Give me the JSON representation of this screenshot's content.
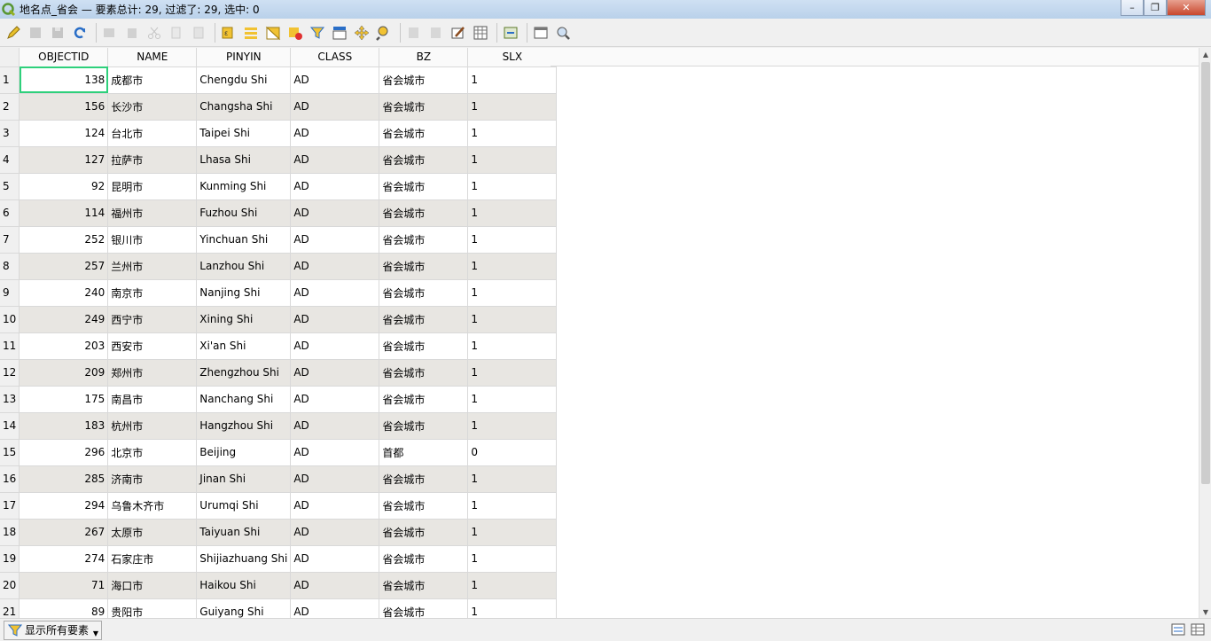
{
  "window": {
    "title": "地名点_省会 — 要素总计: 29, 过滤了: 29, 选中: 0",
    "minimize": "–",
    "maximize": "❐",
    "close": "✕"
  },
  "table": {
    "columns": [
      "OBJECTID",
      "NAME",
      "PINYIN",
      "CLASS",
      "BZ",
      "SLX"
    ],
    "rows": [
      {
        "n": "1",
        "id": "138",
        "name": "成都市",
        "pinyin": "Chengdu Shi",
        "class": "AD",
        "bz": "省会城市",
        "slx": "1"
      },
      {
        "n": "2",
        "id": "156",
        "name": "长沙市",
        "pinyin": "Changsha Shi",
        "class": "AD",
        "bz": "省会城市",
        "slx": "1"
      },
      {
        "n": "3",
        "id": "124",
        "name": "台北市",
        "pinyin": "Taipei Shi",
        "class": "AD",
        "bz": "省会城市",
        "slx": "1"
      },
      {
        "n": "4",
        "id": "127",
        "name": "拉萨市",
        "pinyin": "Lhasa Shi",
        "class": "AD",
        "bz": "省会城市",
        "slx": "1"
      },
      {
        "n": "5",
        "id": "92",
        "name": "昆明市",
        "pinyin": "Kunming Shi",
        "class": "AD",
        "bz": "省会城市",
        "slx": "1"
      },
      {
        "n": "6",
        "id": "114",
        "name": "福州市",
        "pinyin": "Fuzhou Shi",
        "class": "AD",
        "bz": "省会城市",
        "slx": "1"
      },
      {
        "n": "7",
        "id": "252",
        "name": "银川市",
        "pinyin": "Yinchuan Shi",
        "class": "AD",
        "bz": "省会城市",
        "slx": "1"
      },
      {
        "n": "8",
        "id": "257",
        "name": "兰州市",
        "pinyin": "Lanzhou Shi",
        "class": "AD",
        "bz": "省会城市",
        "slx": "1"
      },
      {
        "n": "9",
        "id": "240",
        "name": "南京市",
        "pinyin": "Nanjing Shi",
        "class": "AD",
        "bz": "省会城市",
        "slx": "1"
      },
      {
        "n": "10",
        "id": "249",
        "name": "西宁市",
        "pinyin": "Xining Shi",
        "class": "AD",
        "bz": "省会城市",
        "slx": "1"
      },
      {
        "n": "11",
        "id": "203",
        "name": "西安市",
        "pinyin": "Xi'an Shi",
        "class": "AD",
        "bz": "省会城市",
        "slx": "1"
      },
      {
        "n": "12",
        "id": "209",
        "name": "郑州市",
        "pinyin": "Zhengzhou Shi",
        "class": "AD",
        "bz": "省会城市",
        "slx": "1"
      },
      {
        "n": "13",
        "id": "175",
        "name": "南昌市",
        "pinyin": "Nanchang Shi",
        "class": "AD",
        "bz": "省会城市",
        "slx": "1"
      },
      {
        "n": "14",
        "id": "183",
        "name": "杭州市",
        "pinyin": "Hangzhou Shi",
        "class": "AD",
        "bz": "省会城市",
        "slx": "1"
      },
      {
        "n": "15",
        "id": "296",
        "name": "北京市",
        "pinyin": "Beijing",
        "class": "AD",
        "bz": "首都",
        "slx": "0"
      },
      {
        "n": "16",
        "id": "285",
        "name": "济南市",
        "pinyin": "Jinan Shi",
        "class": "AD",
        "bz": "省会城市",
        "slx": "1"
      },
      {
        "n": "17",
        "id": "294",
        "name": "乌鲁木齐市",
        "pinyin": "Urumqi Shi",
        "class": "AD",
        "bz": "省会城市",
        "slx": "1"
      },
      {
        "n": "18",
        "id": "267",
        "name": "太原市",
        "pinyin": "Taiyuan Shi",
        "class": "AD",
        "bz": "省会城市",
        "slx": "1"
      },
      {
        "n": "19",
        "id": "274",
        "name": "石家庄市",
        "pinyin": "Shijiazhuang Shi",
        "class": "AD",
        "bz": "省会城市",
        "slx": "1"
      },
      {
        "n": "20",
        "id": "71",
        "name": "海口市",
        "pinyin": "Haikou Shi",
        "class": "AD",
        "bz": "省会城市",
        "slx": "1"
      },
      {
        "n": "21",
        "id": "89",
        "name": "贵阳市",
        "pinyin": "Guiyang Shi",
        "class": "AD",
        "bz": "省会城市",
        "slx": "1"
      }
    ]
  },
  "bottom": {
    "filter_label": "显示所有要素"
  },
  "colors": {
    "focus_outline": "#2ed07b",
    "alt_row": "#e8e6e2"
  },
  "icons": [
    "pencil-icon",
    "save-edits-icon",
    "save-icon",
    "refresh-icon",
    "add-feature-icon",
    "delete-icon",
    "cut-icon",
    "copy-icon",
    "paste-icon",
    "select-by-expression-icon",
    "select-all-icon",
    "invert-selection-icon",
    "deselect-icon",
    "filter-icon",
    "move-selection-top-icon",
    "pan-to-selection-icon",
    "zoom-to-selection-icon",
    "new-field-icon",
    "delete-field-icon",
    "field-calculator-icon",
    "conditional-format-icon",
    "actions-icon",
    "dock-icon",
    "form-view-icon"
  ]
}
